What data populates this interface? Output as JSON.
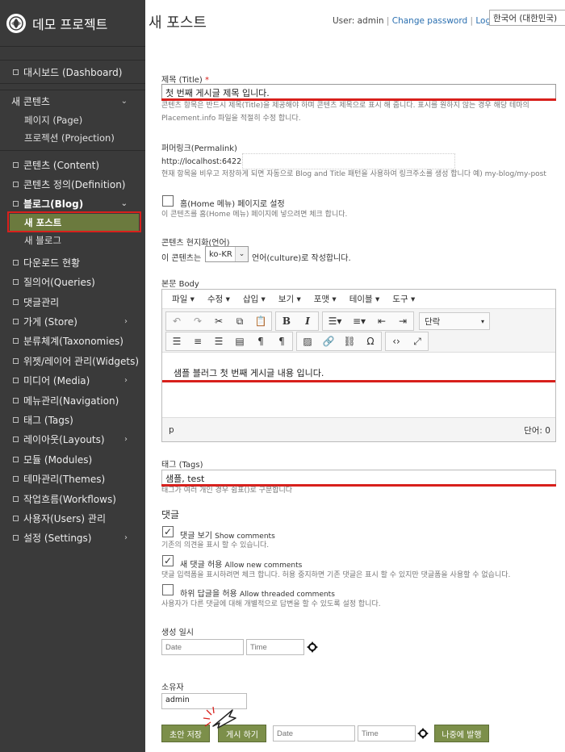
{
  "app": {
    "brand": "데모 프로젝트"
  },
  "sidebar": {
    "dashboard": "대시보드 (Dashboard)",
    "new_content": "새 콘텐츠",
    "new_content_items": [
      "페이지 (Page)",
      "프로젝션 (Projection)"
    ],
    "items_a": [
      {
        "label": "콘텐츠 (Content)"
      },
      {
        "label": "콘텐츠 정의(Definition)"
      }
    ],
    "blog": "블로그(Blog)",
    "blog_items": [
      "새 포스트",
      "새 블로그"
    ],
    "items_b": [
      {
        "label": "다운로드 현황"
      },
      {
        "label": "질의어(Queries)"
      },
      {
        "label": "댓글관리"
      },
      {
        "label": "가게 (Store)"
      },
      {
        "label": "분류체계(Taxonomies)"
      },
      {
        "label": "위젯/레이어 관리(Widgets)"
      },
      {
        "label": "미디어 (Media)"
      },
      {
        "label": "메뉴관리(Navigation)"
      },
      {
        "label": "태그 (Tags)"
      },
      {
        "label": "레이아웃(Layouts)"
      },
      {
        "label": "모듈 (Modules)"
      },
      {
        "label": "테마관리(Themes)"
      },
      {
        "label": "작업흐름(Workflows)"
      },
      {
        "label": "사용자(Users) 관리"
      },
      {
        "label": "설정 (Settings)"
      }
    ]
  },
  "header": {
    "title": "새 포스트",
    "user": "User: admin",
    "change_password": "Change password",
    "logout": "Logout",
    "language": "한국어 (대한민국)"
  },
  "form": {
    "title_label": "제목 (Title)",
    "title_required": "*",
    "title_value": "첫 번째 게시글 제목 입니다.",
    "title_hint_1": "콘텐츠 항목은 반드시 제목(Title)을 제공해야 하며 콘텐츠 제목으로 표시 해 줍니다. 표시를 원하지 않는 경우 해당 테마의",
    "title_hint_2": "Placement.info 파일을 적절히 수정 합니다.",
    "permalink_label": "퍼머링크(Permalink)",
    "permalink_prefix": "http://localhost:64222/",
    "permalink_value": "",
    "permalink_hint": "현재 항목을 비우고 저장하게 되면 자동으로 Blog and Title 패턴을 사용하여 링크주소를 생성 합니다 예) my-blog/my-post",
    "homepage_label": "홈(Home 메뉴) 페이지로 설정",
    "homepage_hint": "이 콘텐츠를 홈(Home 메뉴) 페이지에 넣으려면 체크 합니다.",
    "localization_label": "콘텐츠 현지화(언어)",
    "localization_prefix": "이 콘텐츠는",
    "culture_value": "ko-KR",
    "localization_suffix": "언어(culture)로 작성합니다.",
    "body_label": "본문 Body",
    "editor_menus": [
      "파일",
      "수정",
      "삽입",
      "보기",
      "포맷",
      "테이블",
      "도구"
    ],
    "format_select": "단락",
    "body_value": "샘플 블러그 첫 번째 게시글 내용 입니다.",
    "status_path": "p",
    "word_count": "단어: 0",
    "tags_label": "태그 (Tags)",
    "tags_value": "샘플, test",
    "tags_hint": "태그가 여러 개인 경우 쉼표()로 구분합니다",
    "comments_title": "댓글",
    "show_comments_label": "댓글 보기",
    "show_comments_en": "Show comments",
    "show_comments_hint": "기존의 의견을 표시 할 수 있습니다.",
    "allow_new_label": "새 댓글 허용",
    "allow_new_en": "Allow new comments",
    "allow_new_hint": "댓글 입력폼을 표시하려면 체크 합니다. 허용 중지하면 기존 댓글은 표시 할 수 있지만 댓글폼을 사용할 수 없습니다.",
    "threaded_label": "하위 답글을 허용",
    "threaded_en": "Allow threaded comments",
    "threaded_hint": "사용자가 다른 댓글에 대해 개별적으로 답변을 할 수 있도록 설정 합니다.",
    "created_label": "생성 일시",
    "date_placeholder": "Date",
    "time_placeholder": "Time",
    "owner_label": "소유자",
    "owner_value": "admin",
    "save_draft": "초안 저장",
    "publish_now": "게시 하기",
    "publish_later": "나중에 발행"
  },
  "checkbox_states": {
    "homepage": false,
    "show_comments": true,
    "allow_new": true,
    "threaded": false
  },
  "colors": {
    "sidebar_bg": "#3a3a3a",
    "accent_green": "#7c8f4a",
    "highlight_red": "#d8201c",
    "link_blue": "#2a6fb0"
  }
}
